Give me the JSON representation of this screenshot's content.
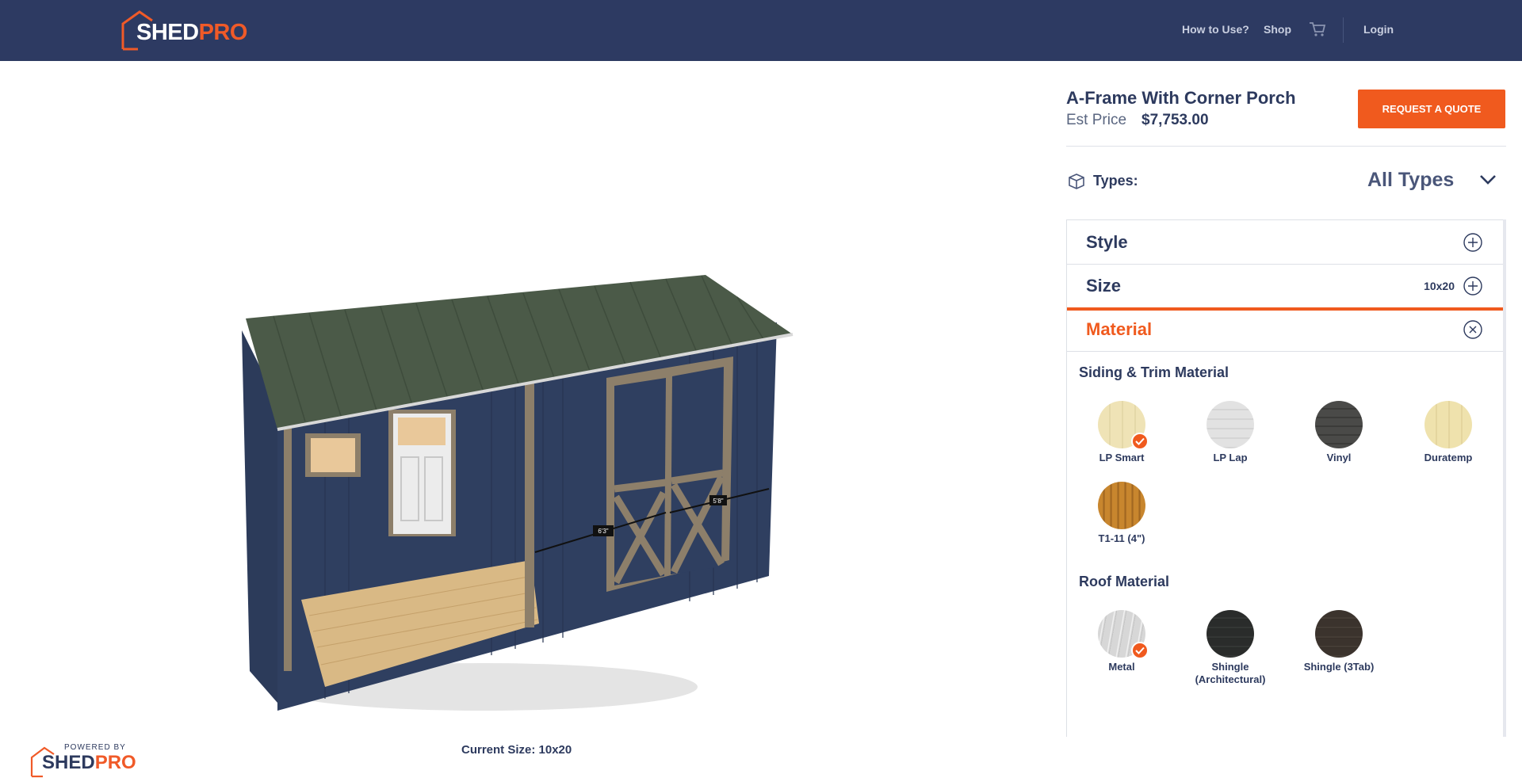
{
  "header": {
    "logo_shed": "SHED",
    "logo_pro": "PRO",
    "nav": {
      "how_to_use": "How to Use?",
      "shop": "Shop",
      "login": "Login"
    }
  },
  "viewer": {
    "current_size_label": "Current Size: 10x20",
    "powered_by": "POWERED BY",
    "powered_shed": "SHED",
    "powered_pro": "PRO",
    "dimension_1": "6'3\"",
    "dimension_2": "5'8\""
  },
  "panel": {
    "model_title": "A-Frame With Corner Porch",
    "est_label": "Est Price",
    "est_price": "$7,753.00",
    "quote_button": "REQUEST A QUOTE",
    "types_label": "Types:",
    "types_value": "All Types",
    "sections": {
      "style": {
        "title": "Style"
      },
      "size": {
        "title": "Size",
        "value": "10x20"
      },
      "material": {
        "title": "Material"
      }
    },
    "siding_title": "Siding & Trim Material",
    "siding": [
      {
        "label": "LP Smart",
        "selected": true
      },
      {
        "label": "LP Lap",
        "selected": false
      },
      {
        "label": "Vinyl",
        "selected": false
      },
      {
        "label": "Duratemp",
        "selected": false
      },
      {
        "label": "T1-11 (4\")",
        "selected": false
      }
    ],
    "roof_title": "Roof Material",
    "roof": [
      {
        "label": "Metal",
        "selected": true
      },
      {
        "label_line1": "Shingle",
        "label_line2": "(Architectural)",
        "selected": false
      },
      {
        "label": "Shingle (3Tab)",
        "selected": false
      }
    ]
  },
  "colors": {
    "header_bg": "#2d3a62",
    "accent": "#f05a1e",
    "text": "#2d3a5e"
  }
}
